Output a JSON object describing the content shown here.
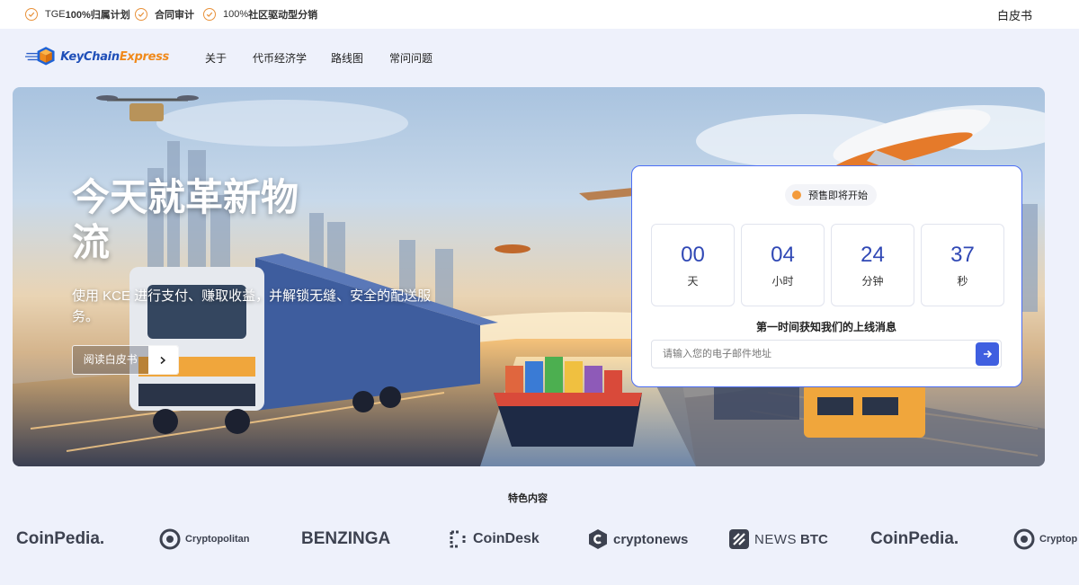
{
  "topbar": {
    "features": [
      {
        "prefix": "TGE ",
        "bold": "100%归属计划"
      },
      {
        "prefix": "",
        "bold": "合同审计"
      },
      {
        "prefix": "100%",
        "bold": "社区驱动型分销"
      }
    ],
    "whitepaper": "白皮书"
  },
  "logo": {
    "part1": "KeyChain",
    "part2": "Express"
  },
  "nav": {
    "items": [
      "关于",
      "代币经济学",
      "路线图",
      "常问问题"
    ]
  },
  "hero": {
    "title": "今天就革新物流",
    "subtitle": "使用 KCE 进行支付、赚取收益，并解锁无缝、安全的配送服务。",
    "cta": "阅读白皮书"
  },
  "presale": {
    "badge": "预售即将开始",
    "countdown": [
      {
        "value": "00",
        "unit": "天"
      },
      {
        "value": "04",
        "unit": "小时"
      },
      {
        "value": "24",
        "unit": "分钟"
      },
      {
        "value": "37",
        "unit": "秒"
      }
    ],
    "notify": "第一时间获知我们的上线消息",
    "email_placeholder": "请输入您的电子邮件地址"
  },
  "featured": {
    "title": "特色内容",
    "outlets": [
      "CoinPedia.",
      "Cryptopolitan",
      "BENZINGA",
      "CoinDesk",
      "cryptonews",
      "NEWS",
      "BTC",
      "CoinPedia.",
      "Cryptop"
    ]
  },
  "colors": {
    "accent": "#3f5fe0",
    "orange": "#f08a1c",
    "bg": "#eef1fb"
  }
}
